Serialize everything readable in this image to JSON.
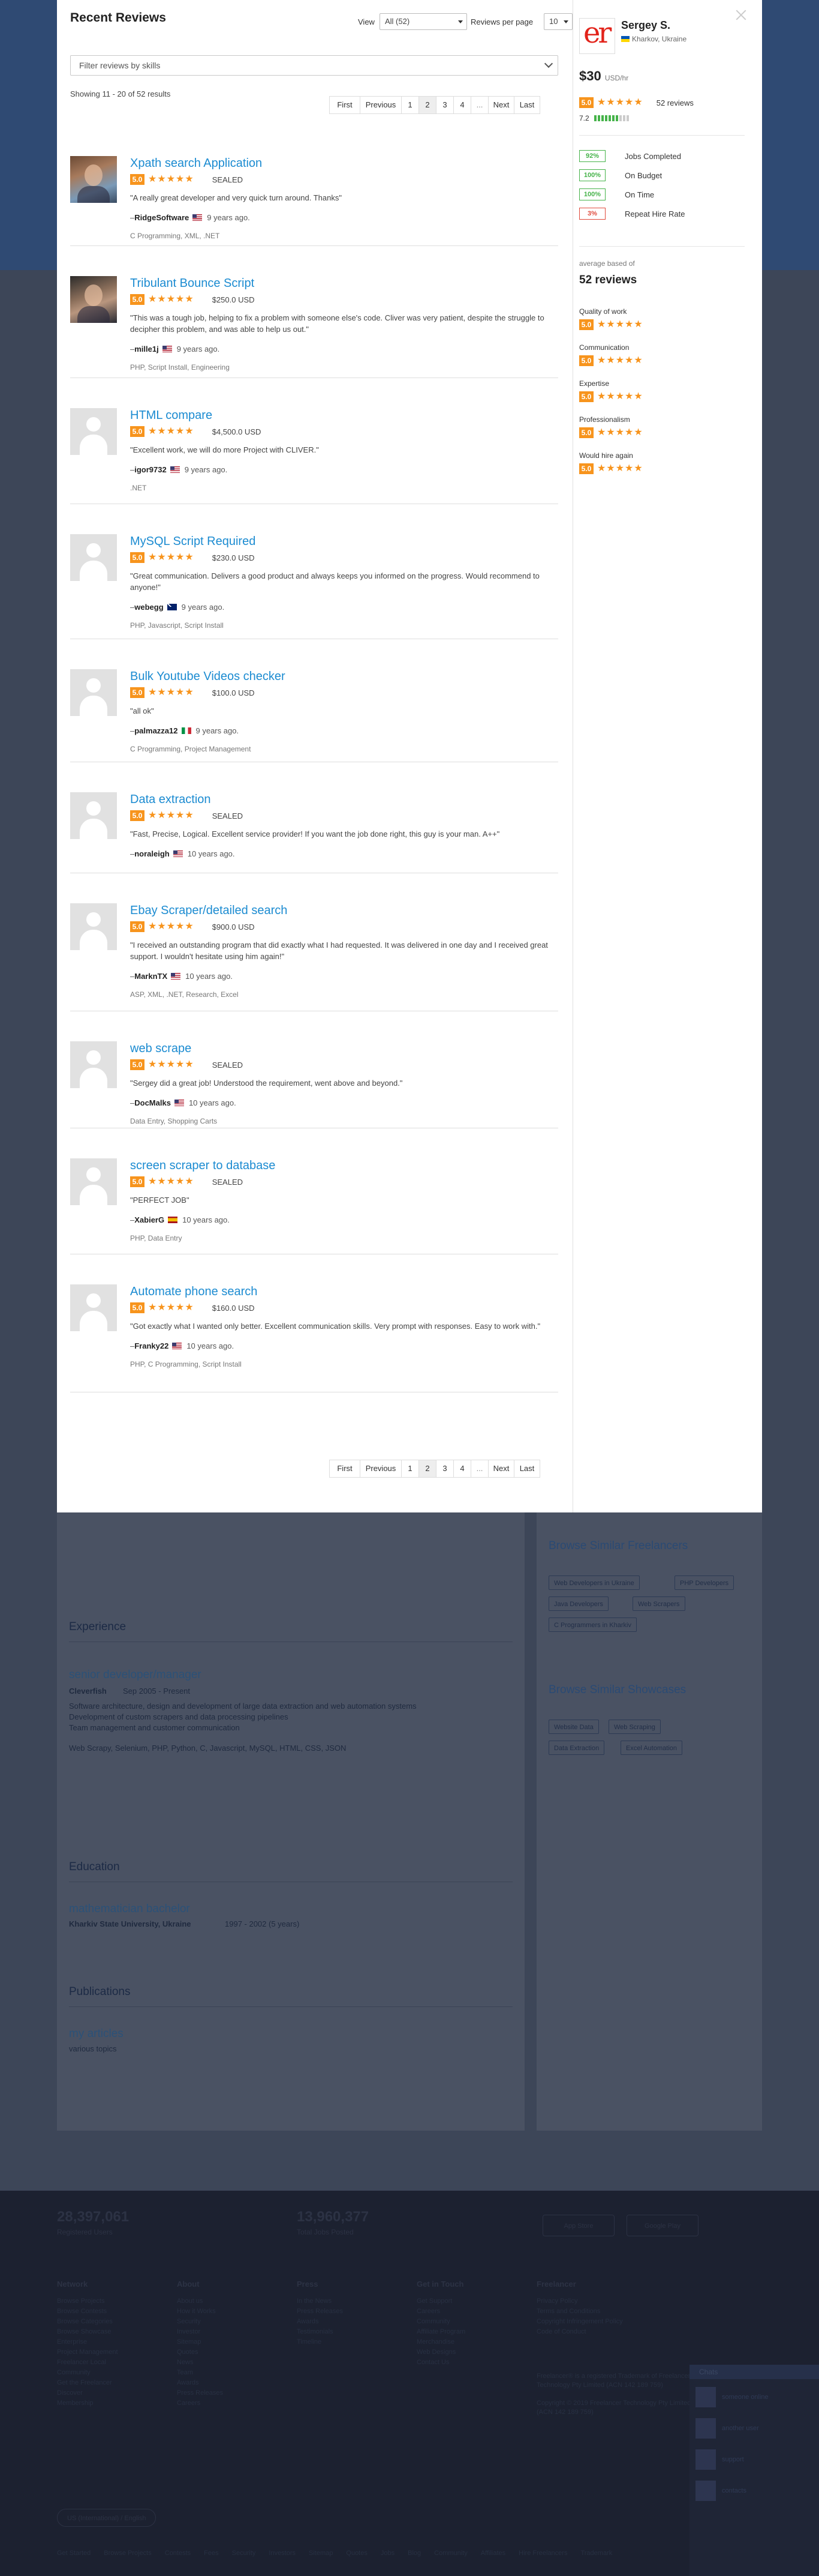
{
  "background": {
    "sections": [
      {
        "heading": "Experience",
        "item_title": "senior developer/manager",
        "item_sub": "Cleverfish",
        "item_date": "Sep 2005 - Present",
        "lines": [
          "Software architecture, design and development of large data extraction and web automation systems",
          "Development of custom scrapers and data processing pipelines",
          "Team management and customer communication"
        ],
        "extra": "Web Scrapy, Selenium, PHP, Python, C, Javascript, MySQL, HTML, CSS, JSON"
      },
      {
        "heading": "Education",
        "item_title": "mathematician bachelor",
        "item_sub": "Kharkiv State University, Ukraine",
        "item_date": "1997 - 2002 (5 years)"
      },
      {
        "heading": "Publications",
        "item_title": "my articles",
        "item_sub": "various topics",
        "item_date": ""
      }
    ],
    "side_headings": [
      "Browse Similar Freelancers",
      "Browse Similar Showcases"
    ],
    "freelancer_chips": [
      "Web Developers in Ukraine",
      "PHP Developers",
      "Java Developers",
      "Web Scrapers",
      "C Programmers in Kharkiv"
    ],
    "showcase_chips": [
      "Website Data",
      "Web Scraping",
      "Data Extraction",
      "Excel Automation"
    ]
  },
  "footer": {
    "stats": [
      {
        "value": "28,397,061",
        "label": "Registered Users"
      },
      {
        "value": "13,960,377",
        "label": "Total Jobs Posted"
      }
    ],
    "app_buttons": [
      "App Store",
      "Google Play"
    ],
    "columns": [
      {
        "title": "Network",
        "items": [
          "Browse Projects",
          "Browse Contests",
          "Browse Categories",
          "Browse Showcase",
          "Enterprise",
          "Project Management",
          "Freelancer Local",
          "Community",
          "Get the Freelancer",
          "Discover",
          "Membership"
        ]
      },
      {
        "title": "About",
        "items": [
          "About us",
          "How it Works",
          "Security",
          "Investor",
          "Sitemap",
          "Quotes",
          "News",
          "Team",
          "Awards",
          "Press Releases",
          "Careers"
        ]
      },
      {
        "title": "Press",
        "items": [
          "In the News",
          "Press Releases",
          "Awards",
          "Testimonials",
          "Timeline"
        ]
      },
      {
        "title": "Get in Touch",
        "items": [
          "Get Support",
          "Careers",
          "Community",
          "Affiliate Program",
          "Merchandise",
          "Web Designs",
          "Contact Us"
        ]
      },
      {
        "title": "Freelancer",
        "items": [
          "Privacy Policy",
          "Terms and Conditions",
          "Copyright Infringement Policy",
          "Code of Conduct"
        ]
      }
    ],
    "contact_lines": [
      "Freelancer® is a registered Trademark of Freelancer",
      "Technology Pty Limited (ACN 142 189 759)",
      "Copyright © 2019 Freelancer Technology Pty Limited",
      "(ACN 142 189 759)"
    ],
    "language": "US (International) / English",
    "bottom_links": [
      "Get Started",
      "Browse Projects",
      "Contests",
      "Fees",
      "Security",
      "Investors",
      "Sitemap",
      "Quotes",
      "Jobs",
      "Blog",
      "Community",
      "Affiliates",
      "Hire Freelancers",
      "Trademark"
    ],
    "chat": {
      "title": "Chats",
      "contacts": [
        "someone online",
        "another user",
        "support",
        "contacts"
      ]
    }
  },
  "modal": {
    "title": "Recent Reviews",
    "view_label": "View",
    "view_value": "All (52)",
    "per_page_label": "Reviews per page",
    "per_page_value": "10",
    "filter_placeholder": "Filter reviews by skills",
    "showing": "Showing 11 - 20 of 52 results",
    "pagination": [
      "First",
      "Previous",
      "1",
      "2",
      "3",
      "4",
      "...",
      "Next",
      "Last"
    ],
    "active_page": "2",
    "reviews": [
      {
        "title": "Xpath search Application",
        "score": "5.0",
        "stars": 5,
        "amount": "SEALED",
        "quote": "\"A really great developer and very quick turn around. Thanks\"",
        "reviewer": "RidgeSoftware",
        "flag": "us",
        "time": "9 years ago.",
        "skills": "C Programming, XML, .NET",
        "thumb": "photo"
      },
      {
        "title": "Tribulant Bounce Script",
        "score": "5.0",
        "stars": 5,
        "amount": "$250.0 USD",
        "quote": "\"This was a tough job, helping to fix a problem with someone else's code. Cliver was very patient, despite the struggle to decipher this problem, and was able to help us out.\"",
        "reviewer": "mille1j",
        "flag": "us",
        "time": "9 years ago.",
        "skills": "PHP, Script Install, Engineering",
        "thumb": "photo2"
      },
      {
        "title": "HTML compare",
        "score": "5.0",
        "stars": 5,
        "amount": "$4,500.0 USD",
        "quote": "\"Excellent work, we will do more Project with CLIVER.\"",
        "reviewer": "igor9732",
        "flag": "us",
        "time": "9 years ago.",
        "skills": ".NET",
        "thumb": "blank"
      },
      {
        "title": "MySQL Script Required",
        "score": "5.0",
        "stars": 5,
        "amount": "$230.0 USD",
        "quote": "\"Great communication. Delivers a good product and always keeps you informed on the progress. Would recommend to anyone!\"",
        "reviewer": "webegg",
        "flag": "au",
        "time": "9 years ago.",
        "skills": "PHP, Javascript, Script Install",
        "thumb": "blank"
      },
      {
        "title": "Bulk Youtube Videos checker",
        "score": "5.0",
        "stars": 5,
        "amount": "$100.0 USD",
        "quote": "\"all ok\"",
        "reviewer": "palmazza12",
        "flag": "it",
        "time": "9 years ago.",
        "skills": "C Programming, Project Management",
        "thumb": "blank"
      },
      {
        "title": "Data extraction",
        "score": "5.0",
        "stars": 5,
        "amount": "SEALED",
        "quote": "\"Fast, Precise, Logical. Excellent service provider! If you want the job done right, this guy is your man. A++\"",
        "reviewer": "noraleigh",
        "flag": "us",
        "time": "10 years ago.",
        "skills": "",
        "thumb": "blank"
      },
      {
        "title": "Ebay Scraper/detailed search",
        "score": "5.0",
        "stars": 5,
        "amount": "$900.0 USD",
        "quote": "\"I received an outstanding program that did exactly what I had requested. It was delivered in one day and I received great support. I wouldn't hesitate using him again!\"",
        "reviewer": "MarknTX",
        "flag": "us",
        "time": "10 years ago.",
        "skills": "ASP, XML, .NET, Research, Excel",
        "thumb": "blank"
      },
      {
        "title": "web scrape",
        "score": "5.0",
        "stars": 5,
        "amount": "SEALED",
        "quote": "\"Sergey did a great job! Understood the requirement, went above and beyond.\"",
        "reviewer": "DocMalks",
        "flag": "us",
        "time": "10 years ago.",
        "skills": "Data Entry, Shopping Carts",
        "thumb": "blank"
      },
      {
        "title": "screen scraper to database",
        "score": "5.0",
        "stars": 5,
        "amount": "SEALED",
        "quote": "\"PERFECT JOB\"",
        "reviewer": "XabierG",
        "flag": "es",
        "time": "10 years ago.",
        "skills": "PHP, Data Entry",
        "thumb": "blank"
      },
      {
        "title": "Automate phone search",
        "score": "5.0",
        "stars": 5,
        "amount": "$160.0 USD",
        "quote": "\"Got exactly what I wanted only better. Excellent communication skills. Very prompt with responses. Easy to work with.\"",
        "reviewer": "Franky22",
        "flag": "us",
        "time": "10 years ago.",
        "skills": "PHP, C Programming, Script Install",
        "thumb": "blank"
      }
    ]
  },
  "profile": {
    "logo_text": "er",
    "name": "Sergey S.",
    "location": "Kharkov, Ukraine",
    "rate": "$30",
    "rate_unit": "USD/hr",
    "score": "5.0",
    "review_count": "52 reviews",
    "earnings_score": "7.2",
    "earnings_level": 0.72,
    "stats": [
      {
        "pct": "92%",
        "label": "Jobs Completed",
        "color": "#46b34a"
      },
      {
        "pct": "100%",
        "label": "On Budget",
        "color": "#46b34a"
      },
      {
        "pct": "100%",
        "label": "On Time",
        "color": "#46b34a"
      },
      {
        "pct": "3%",
        "label": "Repeat Hire Rate",
        "color": "#e04a3c"
      }
    ],
    "average_label": "average based of",
    "average_count": "52 reviews",
    "categories": [
      {
        "label": "Quality of work",
        "score": "5.0"
      },
      {
        "label": "Communication",
        "score": "5.0"
      },
      {
        "label": "Expertise",
        "score": "5.0"
      },
      {
        "label": "Professionalism",
        "score": "5.0"
      },
      {
        "label": "Would hire again",
        "score": "5.0"
      }
    ]
  },
  "colors": {
    "accent_orange": "#f7941d",
    "link_blue": "#1b8bd1",
    "green": "#46b34a",
    "red": "#e04a3c",
    "overlay": "#3d4658"
  }
}
